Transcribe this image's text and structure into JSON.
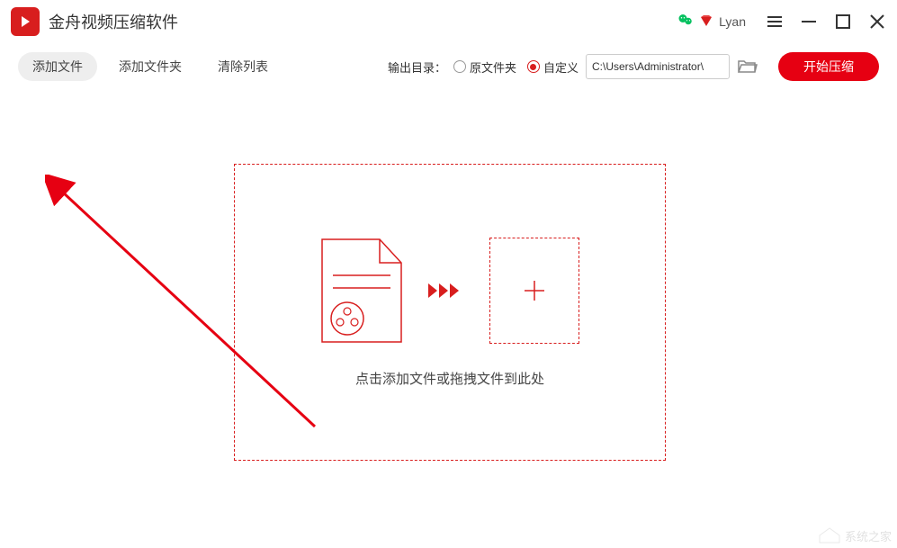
{
  "app": {
    "title": "金舟视频压缩软件",
    "user_name": "Lyan"
  },
  "toolbar": {
    "add_file": "添加文件",
    "add_folder": "添加文件夹",
    "clear_list": "清除列表",
    "output_label": "输出目录：",
    "radio_original": "原文件夹",
    "radio_custom": "自定义",
    "path_value": "C:\\Users\\Administrator\\",
    "start_compress": "开始压缩"
  },
  "dropzone": {
    "hint": "点击添加文件或拖拽文件到此处"
  },
  "watermark": {
    "text": "系统之家"
  }
}
